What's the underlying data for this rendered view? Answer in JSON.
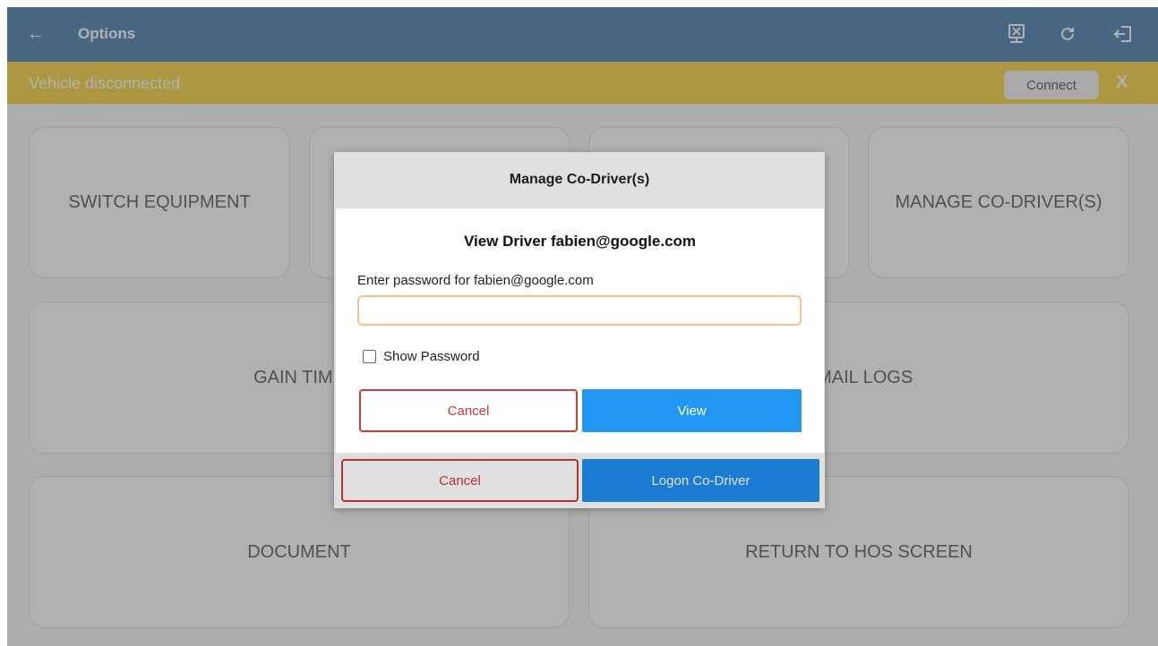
{
  "appbar": {
    "back_icon": "arrow-left-icon",
    "title": "Options",
    "icons": [
      "device-disconnect-icon",
      "refresh-icon",
      "logout-icon"
    ]
  },
  "banner": {
    "message": "Vehicle disconnected",
    "connect_label": "Connect",
    "close_label": "X"
  },
  "tiles": {
    "switch_equipment": "SWITCH EQUIPMENT",
    "manage_co_drivers": "MANAGE CO-DRIVER(S)",
    "gain_time": "GAIN TIME",
    "email_logs": "EMAIL LOGS",
    "document": "DOCUMENT",
    "return_to_hos": "RETURN TO HOS SCREEN"
  },
  "manage_dialog": {
    "title": "Manage Co-Driver(s)",
    "cancel_label": "Cancel",
    "logon_label": "Logon Co-Driver"
  },
  "view_dialog": {
    "title": "View Driver fabien@google.com",
    "password_label": "Enter password for fabien@google.com",
    "password_value": "",
    "show_password_label": "Show Password",
    "show_password_checked": false,
    "cancel_label": "Cancel",
    "view_label": "View"
  },
  "colors": {
    "appbar": "#0d5797",
    "banner": "#f5c400",
    "primary_button": "#2196f3",
    "cancel_border": "#d03a3a"
  }
}
